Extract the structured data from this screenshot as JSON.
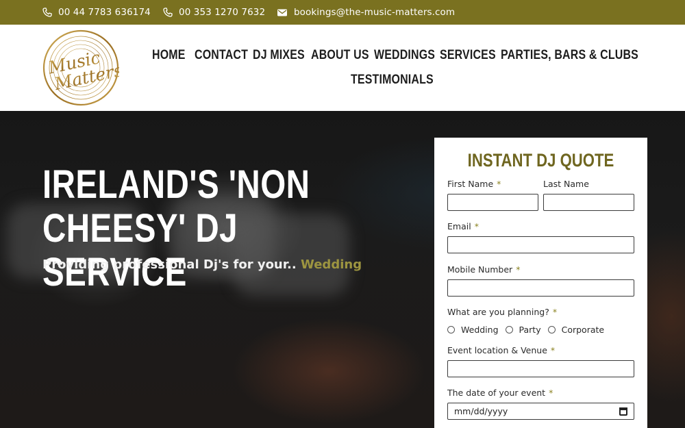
{
  "topbar": {
    "phone_uk": "00 44 7783 636174",
    "phone_ie": "00 353 1270 7632",
    "email": "bookings@the-music-matters.com",
    "bg_color": "#7a7120"
  },
  "logo": {
    "line1": "Music",
    "line2": "Matters"
  },
  "nav": {
    "home": "HOME",
    "contact": "CONTACT",
    "dj_mixes": "DJ MIXES",
    "about": "ABOUT US",
    "weddings": "WEDDINGS",
    "services": "SERVICES",
    "parties": "PARTIES, BARS & CLUBS",
    "testimonials": "TESTIMONIALS"
  },
  "hero": {
    "title": "IRELAND'S 'NON CHEESY' DJ SERVICE",
    "subtitle": "Providing professional Dj's for your..",
    "subtitle_accent": "Wedding"
  },
  "quote_form": {
    "title": "INSTANT DJ QUOTE",
    "first_name_label": "First Name",
    "last_name_label": "Last Name",
    "email_label": "Email",
    "mobile_label": "Mobile Number",
    "planning_label": "What are you planning?",
    "planning_options": [
      "Wedding",
      "Party",
      "Corporate"
    ],
    "location_label": "Event location & Venue",
    "date_label": "The date of your event",
    "date_placeholder": "mm/dd/yyyy",
    "required_mark": "*",
    "accent_color": "#6f6620"
  }
}
